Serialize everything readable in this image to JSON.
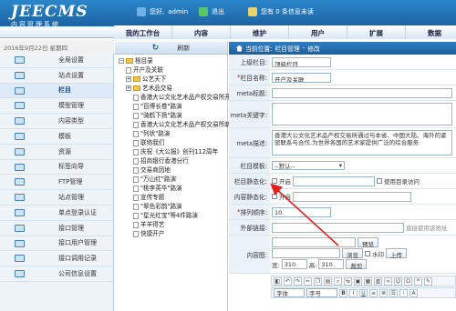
{
  "header": {
    "logo_title": "JEECMS",
    "logo_subtitle": "内容管理系统",
    "greeting": "您好,",
    "user": "admin",
    "logout": "退出",
    "messages": "您有 0 条信息未读"
  },
  "nav": {
    "items": [
      "我的工作台",
      "内容",
      "维护",
      "用户",
      "扩展",
      "数据"
    ]
  },
  "date_text": "2016年9月22日 星期四",
  "sidebar": {
    "items": [
      "全局设置",
      "站点设置",
      "栏目",
      "模型管理",
      "内容类型",
      "模板",
      "资源",
      "标签向导",
      "FTP管理",
      "站点管理",
      "单点登录认证",
      "接口管理",
      "接口用户管理",
      "接口调用记录",
      "公司信息设置"
    ],
    "active_index": 2
  },
  "tree": {
    "refresh_label": "刷新",
    "nodes": [
      {
        "text": "根目录",
        "kind": "folder",
        "depth": 0
      },
      {
        "text": "开户及关联",
        "kind": "page",
        "depth": 1
      },
      {
        "text": "公艺天下",
        "kind": "folder",
        "depth": 1
      },
      {
        "text": "艺术品交易",
        "kind": "folder",
        "depth": 1
      },
      {
        "text": "香港大公文化艺术品产权交易所开业庆典",
        "kind": "page",
        "depth": 2
      },
      {
        "text": "\"百博长卷\"路演",
        "kind": "page",
        "depth": 2
      },
      {
        "text": "\"骑鹤下扬\"路演",
        "kind": "page",
        "depth": 2
      },
      {
        "text": "香港大公文化艺术品产权交易所新春雅聚",
        "kind": "page",
        "depth": 2
      },
      {
        "text": "\"列状\"路演",
        "kind": "page",
        "depth": 2
      },
      {
        "text": "联络我们",
        "kind": "page",
        "depth": 2
      },
      {
        "text": "庆祝《大公报》创刊112周年",
        "kind": "page",
        "depth": 2
      },
      {
        "text": "招商银行香港分行",
        "kind": "page",
        "depth": 2
      },
      {
        "text": "交易商因地",
        "kind": "page",
        "depth": 2
      },
      {
        "text": "\"万山红\"路演",
        "kind": "page",
        "depth": 2
      },
      {
        "text": "\"桃李英华\"路演",
        "kind": "page",
        "depth": 2
      },
      {
        "text": "宣传专题",
        "kind": "page",
        "depth": 2
      },
      {
        "text": "\"翠色彩韵\"路演",
        "kind": "page",
        "depth": 2
      },
      {
        "text": "\"星光红宝\"等4件路演",
        "kind": "page",
        "depth": 2
      },
      {
        "text": "羊羊得艺",
        "kind": "page",
        "depth": 2
      },
      {
        "text": "快捷开户",
        "kind": "page",
        "depth": 2
      }
    ]
  },
  "breadcrumb": {
    "parts": [
      "当前位置:",
      "栏目管理",
      "-",
      "修改"
    ]
  },
  "form": {
    "parent_label": "上级栏目:",
    "parent_value": "顶级栏目",
    "name_label": "栏目名称:",
    "name_value": "开户及关联",
    "meta_title_label": "meta标题:",
    "meta_keywords_label": "meta关键字:",
    "meta_desc_label": "meta描述:",
    "meta_desc_value": "香港大公文化艺术品产权交易所通过与本省、中国大陆、海外的紧密联系与合作,为世界各国的艺术家提供广泛的综合服务",
    "template_label": "栏目模板:",
    "template_value": "--默认--",
    "static_channel_label": "栏目静态化:",
    "static_content_label": "内容静态化:",
    "open_label": "开启",
    "use_dir_label": "使用目录访问",
    "order_label": "排列顺序:",
    "order_value": "10",
    "link_label": "外部链接:",
    "link_hint": "直接使用该地址",
    "image_label": "内容图:",
    "preview_label": "预览",
    "browse_label": "浏览",
    "watermark_label": "水印",
    "upload_label": "上传",
    "width_label": "宽:",
    "width_value": "310",
    "height_label": "高:",
    "height_value": "310",
    "crop_label": "裁剪",
    "font_label": "字体",
    "size_label": "字号"
  },
  "colors": {
    "header_blue": "#1a5d9c",
    "arrow_red": "#e02020"
  }
}
